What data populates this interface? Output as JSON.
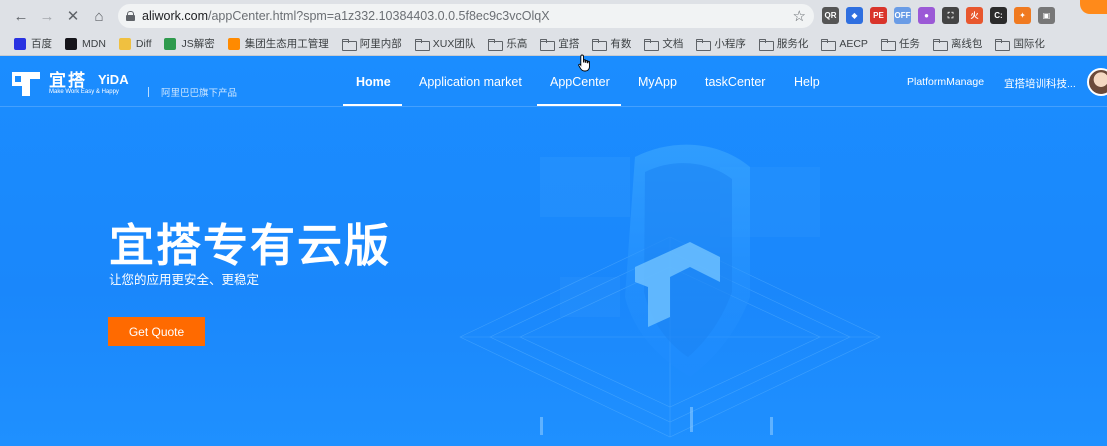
{
  "browser": {
    "url_host": "aliwork.com",
    "url_path": "/appCenter.html?spm=a1z332.10384403.0.0.5f8ec9c3vcOlqX",
    "bookmarks": [
      {
        "label": "百度",
        "type": "favicon",
        "color": "#2932e1"
      },
      {
        "label": "MDN",
        "type": "favicon",
        "color": "#15141a"
      },
      {
        "label": "Diff",
        "type": "favicon",
        "color": "#f0c040"
      },
      {
        "label": "JS解密",
        "type": "favicon",
        "color": "#2e9a4d"
      },
      {
        "label": "集团生态用工管理",
        "type": "favicon",
        "color": "#ff8a00"
      },
      {
        "label": "阿里内部",
        "type": "folder"
      },
      {
        "label": "XUX团队",
        "type": "folder"
      },
      {
        "label": "乐高",
        "type": "folder"
      },
      {
        "label": "宜搭",
        "type": "folder"
      },
      {
        "label": "有数",
        "type": "folder"
      },
      {
        "label": "文档",
        "type": "folder"
      },
      {
        "label": "小程序",
        "type": "folder"
      },
      {
        "label": "服务化",
        "type": "folder"
      },
      {
        "label": "AECP",
        "type": "folder"
      },
      {
        "label": "任务",
        "type": "folder"
      },
      {
        "label": "离线包",
        "type": "folder"
      },
      {
        "label": "国际化",
        "type": "folder"
      }
    ],
    "extensions": [
      {
        "name": "qr-extension-icon",
        "color": "#555555",
        "text": "QR"
      },
      {
        "name": "layers-extension-icon",
        "color": "#2f6fe0",
        "text": "◆"
      },
      {
        "name": "pe-extension-icon",
        "color": "#d9342b",
        "text": "PE"
      },
      {
        "name": "off-extension-icon",
        "color": "#6a9ce6",
        "text": "OFF"
      },
      {
        "name": "color-picker-extension-icon",
        "color": "#9b59d6",
        "text": "●"
      },
      {
        "name": "capture-extension-icon",
        "color": "#444444",
        "text": "⛶"
      },
      {
        "name": "fire-extension-icon",
        "color": "#e8572e",
        "text": "火"
      },
      {
        "name": "terminal-extension-icon",
        "color": "#2b2b2b",
        "text": "C:"
      },
      {
        "name": "puzzle-extension-icon",
        "color": "#f07a20",
        "text": "✦"
      },
      {
        "name": "gift-extension-icon",
        "color": "#777777",
        "text": "▣"
      }
    ]
  },
  "site": {
    "logo_cn": "宜搭",
    "logo_en": "YiDA",
    "logo_slogan": "Make Work Easy & Happy",
    "logo_tag": "阿里巴巴旗下产品",
    "nav": [
      {
        "label": "Home",
        "active": true
      },
      {
        "label": "Application market",
        "active": false
      },
      {
        "label": "AppCenter",
        "active": false,
        "hover": true
      },
      {
        "label": "MyApp",
        "active": false
      },
      {
        "label": "taskCenter",
        "active": false
      },
      {
        "label": "Help",
        "active": false
      }
    ],
    "platform_manage": "PlatformManage",
    "org_name": "宜搭培训科技..."
  },
  "hero": {
    "title": "宜搭专有云版",
    "subtitle": "让您的应用更安全、更稳定",
    "cta_label": "Get Quote"
  },
  "colors": {
    "brand_blue": "#1a8cff",
    "cta_orange": "#ff6a00"
  }
}
